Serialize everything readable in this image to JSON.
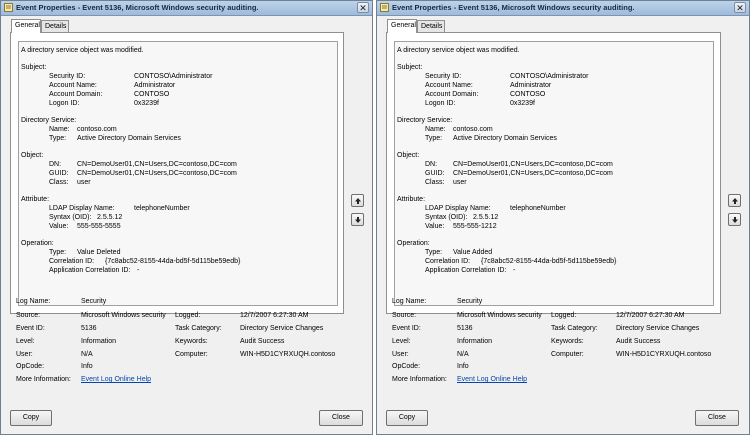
{
  "dialogs": [
    {
      "title": "Event Properties - Event 5136, Microsoft Windows security auditing.",
      "tabs": [
        "General",
        "Details"
      ],
      "message": {
        "summary": "A directory service object was modified.",
        "subject_header": "Subject:",
        "security_id_label": "Security ID:",
        "security_id": "CONTOSO\\Administrator",
        "account_name_label": "Account Name:",
        "account_name": "Administrator",
        "account_domain_label": "Account Domain:",
        "account_domain": "CONTOSO",
        "logon_id_label": "Logon ID:",
        "logon_id": "0x3239f",
        "ds_header": "Directory Service:",
        "ds_name_label": "Name:",
        "ds_name": "contoso.com",
        "ds_type_label": "Type:",
        "ds_type": "Active Directory Domain Services",
        "object_header": "Object:",
        "dn_label": "DN:",
        "dn": "CN=DemoUser01,CN=Users,DC=contoso,DC=com",
        "guid_label": "GUID:",
        "guid": "CN=DemoUser01,CN=Users,DC=contoso,DC=com",
        "class_label": "Class:",
        "class": "user",
        "attribute_header": "Attribute:",
        "ldap_label": "LDAP Display Name:",
        "ldap": "telephoneNumber",
        "syntax_label": "Syntax (OID):",
        "syntax": "2.5.5.12",
        "value_label": "Value:",
        "value": "555-555-5555",
        "operation_header": "Operation:",
        "op_type_label": "Type:",
        "op_type": "Value Deleted",
        "corr_label": "Correlation ID:",
        "corr": "{7c8abc52-8155-44da-bd5f-5d115be59edb}",
        "app_corr_label": "Application Correlation ID:",
        "app_corr": "-"
      },
      "details": {
        "log_name_label": "Log Name:",
        "log_name": "Security",
        "source_label": "Source:",
        "source": "Microsoft Windows security",
        "logged_label": "Logged:",
        "logged": "12/7/2007 6:27:30 AM",
        "event_id_label": "Event ID:",
        "event_id": "5136",
        "task_label": "Task Category:",
        "task": "Directory Service Changes",
        "level_label": "Level:",
        "level": "Information",
        "keywords_label": "Keywords:",
        "keywords": "Audit Success",
        "user_label": "User:",
        "user": "N/A",
        "computer_label": "Computer:",
        "computer": "WIN-H5D1CYRXUQH.contoso",
        "opcode_label": "OpCode:",
        "opcode": "Info",
        "more_info_label": "More Information:",
        "more_info_link": "Event Log Online Help"
      },
      "buttons": {
        "copy": "Copy",
        "close": "Close"
      }
    },
    {
      "title": "Event Properties - Event 5136, Microsoft Windows security auditing.",
      "tabs": [
        "General",
        "Details"
      ],
      "message": {
        "summary": "A directory service object was modified.",
        "subject_header": "Subject:",
        "security_id_label": "Security ID:",
        "security_id": "CONTOSO\\Administrator",
        "account_name_label": "Account Name:",
        "account_name": "Administrator",
        "account_domain_label": "Account Domain:",
        "account_domain": "CONTOSO",
        "logon_id_label": "Logon ID:",
        "logon_id": "0x3239f",
        "ds_header": "Directory Service:",
        "ds_name_label": "Name:",
        "ds_name": "contoso.com",
        "ds_type_label": "Type:",
        "ds_type": "Active Directory Domain Services",
        "object_header": "Object:",
        "dn_label": "DN:",
        "dn": "CN=DemoUser01,CN=Users,DC=contoso,DC=com",
        "guid_label": "GUID:",
        "guid": "CN=DemoUser01,CN=Users,DC=contoso,DC=com",
        "class_label": "Class:",
        "class": "user",
        "attribute_header": "Attribute:",
        "ldap_label": "LDAP Display Name:",
        "ldap": "telephoneNumber",
        "syntax_label": "Syntax (OID):",
        "syntax": "2.5.5.12",
        "value_label": "Value:",
        "value": "555-555-1212",
        "operation_header": "Operation:",
        "op_type_label": "Type:",
        "op_type": "Value Added",
        "corr_label": "Correlation ID:",
        "corr": "{7c8abc52-8155-44da-bd5f-5d115be59edb}",
        "app_corr_label": "Application Correlation ID:",
        "app_corr": "-"
      },
      "details": {
        "log_name_label": "Log Name:",
        "log_name": "Security",
        "source_label": "Source:",
        "source": "Microsoft Windows security",
        "logged_label": "Logged:",
        "logged": "12/7/2007 6:27:30 AM",
        "event_id_label": "Event ID:",
        "event_id": "5136",
        "task_label": "Task Category:",
        "task": "Directory Service Changes",
        "level_label": "Level:",
        "level": "Information",
        "keywords_label": "Keywords:",
        "keywords": "Audit Success",
        "user_label": "User:",
        "user": "N/A",
        "computer_label": "Computer:",
        "computer": "WIN-H5D1CYRXUQH.contoso",
        "opcode_label": "OpCode:",
        "opcode": "Info",
        "more_info_label": "More Information:",
        "more_info_link": "Event Log Online Help"
      },
      "buttons": {
        "copy": "Copy",
        "close": "Close"
      }
    }
  ]
}
